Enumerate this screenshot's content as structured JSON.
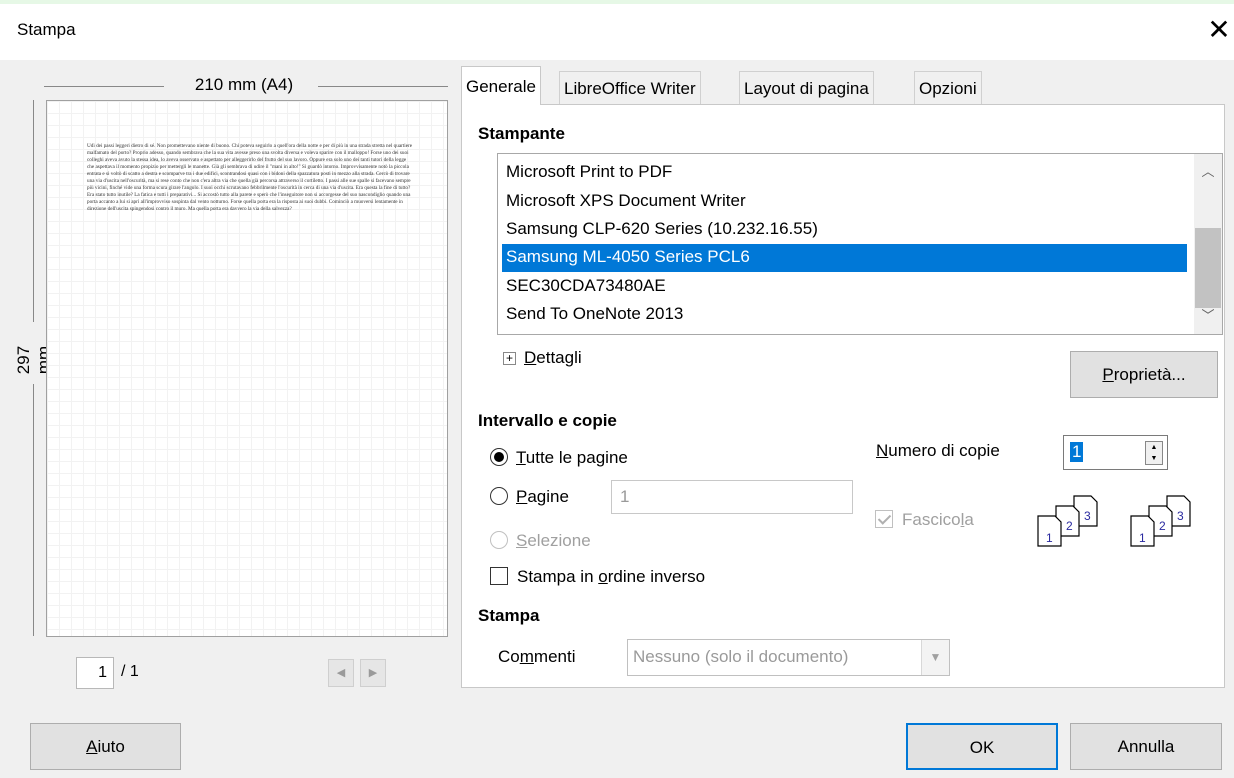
{
  "window": {
    "title": "Stampa",
    "close_glyph": "✕"
  },
  "preview": {
    "width_label": "210 mm (A4)",
    "height_label": "297 mm",
    "body_text": "Udì dei passi leggeri dietro di sé. Non promettevano niente di buono. Chi poteva seguirlo a quell'ora della notte e per di più in una strada stretta nel quartiere malfamato del porto? Proprio adesso, quando sembrava che la sua vita avesse preso una svolta diversa e voleva sparire con il malloppo! Forse uno dei suoi colleghi aveva avuto la stessa idea, lo aveva osservato e aspettato per alleggerirlo del frutto del suo lavoro. Oppure era solo uno dei tanti tutori della legge che aspettava il momento propizio per mettergli le manette. Già gli sembrava di udire il \"mani in alto!\" Si guardò intorno. Improvvisamente notò la piccola entrata e si voltò di scatto a destra e scomparve tra i due edifici, scontrandosi quasi con i bidoni della spazzatura posti in mezzo alla strada. Cercò di trovare una via d'uscita nell'oscurità, ma si rese conto che non c'era altra via che quella già percorsa attraverso il cortiletto. I passi alle sue spalle si facevano sempre più vicini, finché vide una forma scura girare l'angolo. I suoi occhi scrutavano febbrilmente l'oscurità in cerca di una via d'uscita. Era questa la fine di tutto? Era stato tutto inutile? La fatica e tutti i preparativi... Si accostò tutto alla parete e sperò che l'inseguitore non si accorgesse del suo nascondiglio quando una porta accanto a lui si aprì all'improvviso sospinta dal vento notturno. Forse quella porta era la risposta ai suoi dubbi. Cominciò a muoversi lentamente in direzione dell'uscita spingendosi contro il muro. Ma quella porta era davvero la via della salvezza?",
    "page_current": "1",
    "page_total": "/ 1",
    "prev_glyph": "◀",
    "next_glyph": "▶"
  },
  "tabs": [
    {
      "label": "Generale",
      "active": true
    },
    {
      "label": "LibreOffice Writer",
      "active": false
    },
    {
      "label": "Layout di pagina",
      "active": false
    },
    {
      "label": "Opzioni",
      "active": false
    }
  ],
  "printer": {
    "section_title": "Stampante",
    "items": [
      "Microsoft Print to PDF",
      "Microsoft XPS Document Writer",
      "Samsung CLP-620 Series (10.232.16.55)",
      "Samsung ML-4050 Series PCL6",
      "SEC30CDA73480AE",
      "Send To OneNote 2013"
    ],
    "selected_index": 3,
    "details_prefix": "D",
    "details_rest": "ettagli",
    "expander_glyph": "+",
    "properties_prefix": "P",
    "properties_rest": "roprietà..."
  },
  "range": {
    "section_title": "Intervallo e copie",
    "all_pages_prefix": "T",
    "all_pages_rest": "utte le pagine",
    "pages_prefix": "P",
    "pages_rest": "agine",
    "pages_value": "1",
    "selection_prefix": "S",
    "selection_rest": "elezione",
    "reverse_a": "Stampa in ",
    "reverse_u": "o",
    "reverse_b": "rdine inverso",
    "copies_prefix": "N",
    "copies_rest": "umero di copie",
    "copies_value": "1",
    "collate_a": "Fascico",
    "collate_u": "l",
    "collate_b": "a",
    "collate_pages": [
      "1",
      "2",
      "3"
    ]
  },
  "print_section": {
    "section_title": "Stampa",
    "comments_a": "Co",
    "comments_u": "m",
    "comments_b": "menti",
    "comments_value": "Nessuno (solo il documento)"
  },
  "buttons": {
    "help_prefix": "A",
    "help_rest": "iuto",
    "ok": "OK",
    "cancel": "Annulla"
  },
  "colors": {
    "accent": "#0078d7",
    "selection": "#0078d7"
  }
}
